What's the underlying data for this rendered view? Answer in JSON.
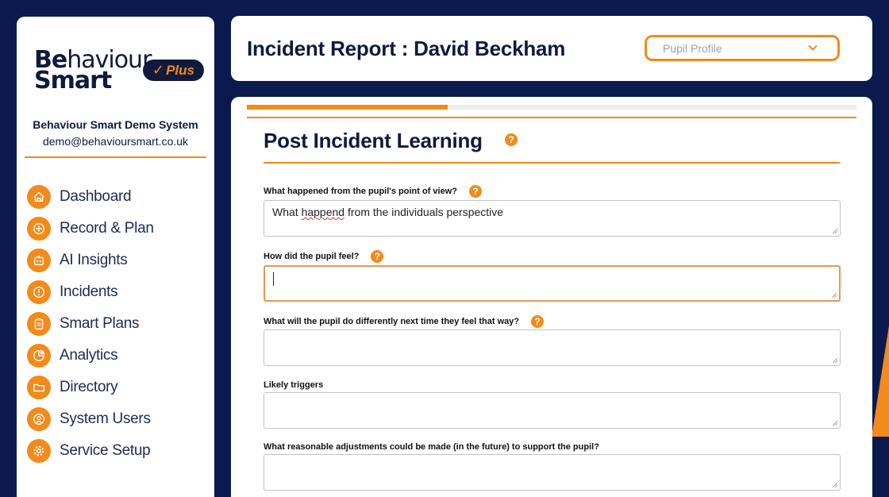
{
  "brand": {
    "logo_line1_a": "Be",
    "logo_line1_b": "haviour",
    "logo_line2": "Smart",
    "badge": "Plus",
    "badge_tick": "✓"
  },
  "org": {
    "name": "Behaviour Smart Demo System",
    "email": "demo@behavioursmart.co.uk"
  },
  "sidebar": {
    "items": [
      {
        "label": "Dashboard",
        "icon": "home-icon"
      },
      {
        "label": "Record & Plan",
        "icon": "plus-circle-icon"
      },
      {
        "label": "AI Insights",
        "icon": "robot-icon"
      },
      {
        "label": "Incidents",
        "icon": "alert-icon"
      },
      {
        "label": "Smart Plans",
        "icon": "clipboard-icon"
      },
      {
        "label": "Analytics",
        "icon": "pie-chart-icon"
      },
      {
        "label": "Directory",
        "icon": "folder-icon"
      },
      {
        "label": "System Users",
        "icon": "user-icon"
      },
      {
        "label": "Service Setup",
        "icon": "gear-icon"
      }
    ]
  },
  "header": {
    "title": "Incident Report : David Beckham",
    "profile_select": "Pupil Profile"
  },
  "form": {
    "progress_fraction": 0.33,
    "section_title": "Post Incident Learning",
    "questions": [
      {
        "label": "What happened from the pupil's point of view?",
        "value_pre": "What ",
        "value_misspelt": "happend",
        "value_post": " from the individuals perspective",
        "has_help": true
      },
      {
        "label": "How did the pupil feel?",
        "value": "",
        "has_help": true,
        "focused": true
      },
      {
        "label": "What will the pupil do differently next time they feel that way?",
        "value": "",
        "has_help": true
      },
      {
        "label": "Likely triggers",
        "value": "",
        "has_help": false
      },
      {
        "label": "What reasonable adjustments could be made (in the future) to support the pupil?",
        "value": "",
        "has_help": false
      }
    ]
  },
  "colors": {
    "background": "#0b1a4e",
    "accent": "#f28a1c",
    "navy": "#0f1a3d"
  }
}
